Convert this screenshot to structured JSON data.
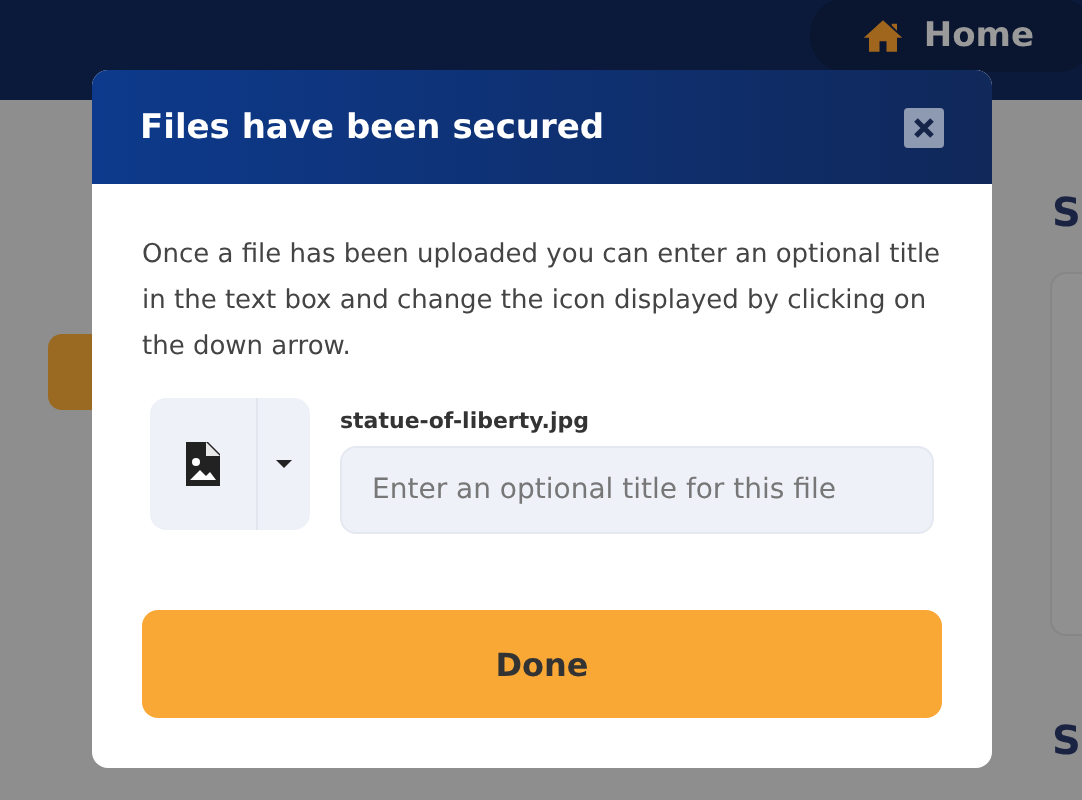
{
  "navbar": {
    "home_link": "Home"
  },
  "side_headings": [
    "S",
    "S"
  ],
  "modal": {
    "title": "Files have been secured",
    "instructions": "Once a file has been uploaded you can enter an optional title in the text box and change the icon displayed by clicking on the down arrow.",
    "files": [
      {
        "filename": "statue-of-liberty.jpg",
        "title_field": {
          "placeholder": "Enter an optional title for this file"
        }
      }
    ],
    "done_button": "Done"
  }
}
